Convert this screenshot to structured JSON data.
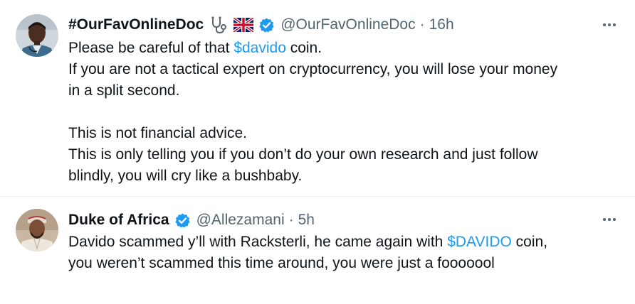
{
  "tweets": [
    {
      "display_name": "#OurFavOnlineDoc",
      "emoji_icons": [
        "stethoscope-icon",
        "uk-flag-icon"
      ],
      "verified": true,
      "handle": "@OurFavOnlineDoc",
      "separator": "·",
      "time": "16h",
      "body": {
        "l1_pre": "Please be careful of that ",
        "l1_link": "$davido",
        "l1_post": " coin.",
        "l2": "If you are not a tactical expert on cryptocurrency, you will lose your money",
        "l3": "in a split second.",
        "l4": "This is not financial advice.",
        "l5": "This is only telling you if you don’t do your own research and just follow",
        "l6": "blindly, you will cry like a bushbaby."
      }
    },
    {
      "display_name": "Duke of Africa",
      "verified": true,
      "handle": "@Allezamani",
      "separator": "·",
      "time": "5h",
      "body": {
        "l1_pre": "Davido scammed y’ll with Racksterli, he came again with ",
        "l1_link": "$DAVIDO",
        "l1_post": " coin,",
        "l2": "you weren’t scammed this time around, you were just a fooooool"
      }
    }
  ],
  "colors": {
    "text": "#0f1419",
    "secondary": "#536471",
    "link": "#1d9bf0",
    "verified": "#1d9bf0",
    "divider": "#eff3f4"
  }
}
